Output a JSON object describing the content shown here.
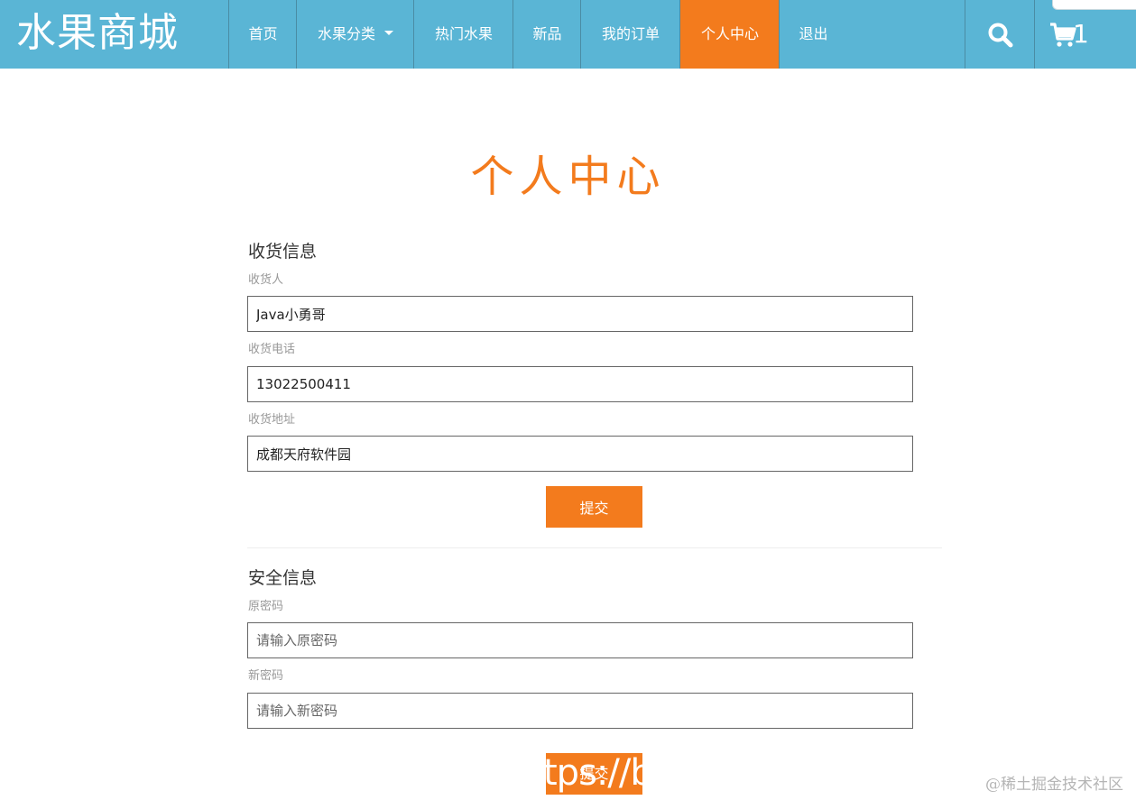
{
  "header": {
    "brand": "水果商城",
    "nav": [
      {
        "label": "首页"
      },
      {
        "label": "水果分类"
      },
      {
        "label": "热门水果"
      },
      {
        "label": "新品"
      },
      {
        "label": "我的订单"
      },
      {
        "label": "个人中心",
        "active": true
      },
      {
        "label": "退出"
      }
    ],
    "search_icon": "search-icon",
    "cart_icon": "cart-icon",
    "cart_count": "1"
  },
  "page": {
    "title": "个人中心"
  },
  "shipping": {
    "heading": "收货信息",
    "name_label": "收货人",
    "name_value": "Java小勇哥",
    "phone_label": "收货电话",
    "phone_value": "13022500411",
    "address_label": "收货地址",
    "address_value": "成都天府软件园",
    "submit_label": "提交"
  },
  "security": {
    "heading": "安全信息",
    "old_password_label": "原密码",
    "old_password_placeholder": "请输入原密码",
    "new_password_label": "新密码",
    "new_password_placeholder": "请输入新密码",
    "submit_label": "提交",
    "overlay_text": "tps://b"
  },
  "watermark": "@稀土掘金技术社区",
  "colors": {
    "navbar": "#5ab5d5",
    "accent": "#f37b1d"
  }
}
